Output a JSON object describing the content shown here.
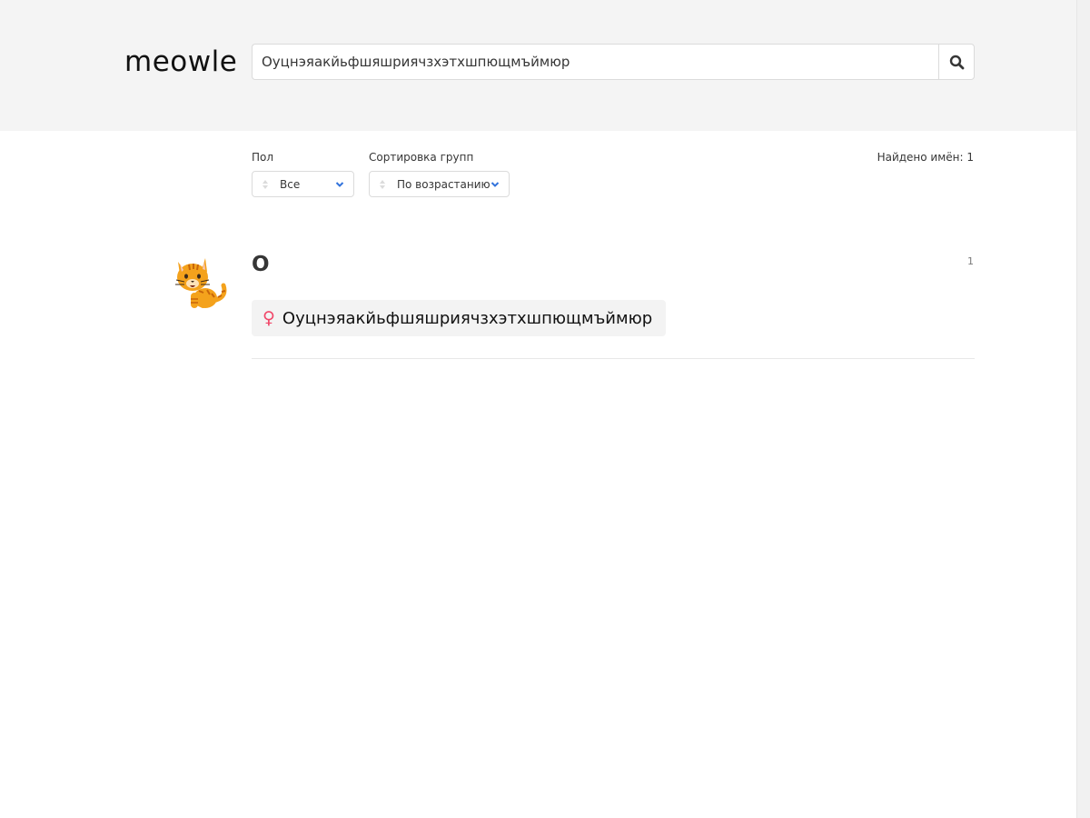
{
  "header": {
    "logo": "meowle",
    "search": {
      "value": "Оуцнэяакйьфшяшриячзхэтхшпющмъймюр",
      "button_icon": "search-icon"
    }
  },
  "filters": {
    "gender": {
      "label": "Пол",
      "value": "Все"
    },
    "sort": {
      "label": "Сортировка групп",
      "value": "По возрастанию"
    },
    "found_text": "Найдено имён: 1"
  },
  "groups": [
    {
      "letter": "О",
      "count": "1",
      "icon": "cat-icon",
      "names": [
        {
          "gender_icon": "♀",
          "gender_color": "#f14668",
          "name": "Оуцнэяакйьфшяшриячзхэтхшпющмъймюр"
        }
      ]
    }
  ],
  "colors": {
    "header_bg": "#f4f4f4",
    "accent": "#3273dc",
    "female": "#f14668"
  }
}
